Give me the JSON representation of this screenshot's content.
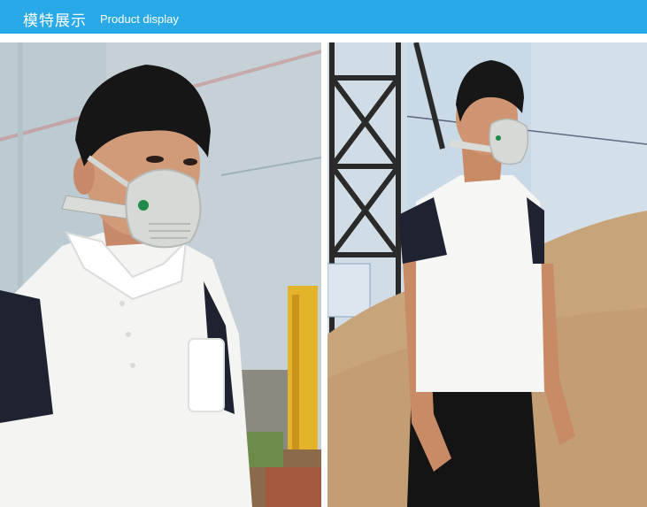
{
  "header": {
    "title_cn": "模特展示",
    "title_en": "Product display"
  },
  "colors": {
    "header_bg": "#2aa9e8",
    "wall": "#c7d2d8",
    "shirt": "#ffffff",
    "sleeve": "#1d2130",
    "mask": "#d6d8d6",
    "sand": "#c7a27a",
    "sky": "#c4d6e4"
  },
  "photos": [
    {
      "id": "left",
      "content": "model-wearing-mask-closeup"
    },
    {
      "id": "right",
      "content": "model-wearing-mask-standing-sand-pile"
    }
  ]
}
